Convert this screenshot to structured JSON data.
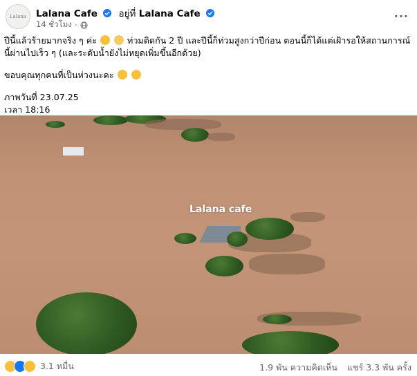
{
  "post": {
    "page_name": "Lalana Cafe",
    "avatar_text": "Lalana",
    "at_prefix": "อยู่ที่",
    "location_name": "Lalana Cafe",
    "time_ago": "14 ชั่วโมง",
    "audience_icon": "globe-icon",
    "more_icon": "more-icon",
    "more_label": "···",
    "text_line1a": "ปีนี้แล้วร้ายมากจริง ๆ ค่ะ",
    "text_line1b": "ท่วมติดกัน 2 ปี และปีนี้ก็ท่วมสูงกว่าปีก่อน ตอนนี้ก็ได้แต่เฝ้ารอให้สถานการณ์นี้ผ่านไปเร็ว ๆ (และระดับน้ำยังไม่หยุดเพิ่มขึ้นอีกด้วย)",
    "text_line2": "ขอบคุณทุกคนที่เป็นห่วงนะคะ",
    "photo_date": "ภาพวันที่ 23.07.25",
    "photo_time": "เวลา 18:16",
    "photo_watermark": "Lalana cafe"
  },
  "footer": {
    "reactions": [
      "care",
      "like",
      "sad"
    ],
    "reaction_count": "3.1 หมื่น",
    "comments": "1.9 พัน ความคิดเห็น",
    "shares": "แชร์ 3.3 พัน ครั้ง"
  },
  "colors": {
    "brand_blue": "#1877f2",
    "secondary_text": "#65676b",
    "flood_water": "#c19274"
  }
}
